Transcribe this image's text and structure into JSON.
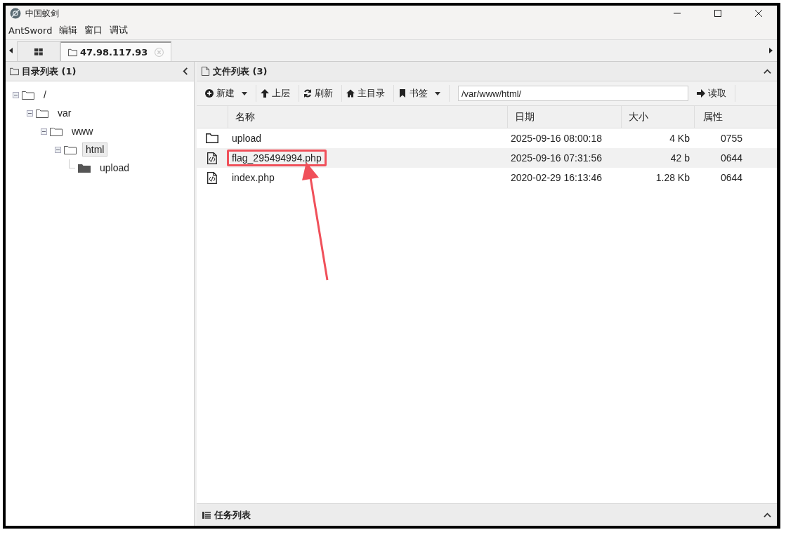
{
  "window": {
    "title": "中国蚁剑"
  },
  "menu": [
    "AntSword",
    "编辑",
    "窗口",
    "调试"
  ],
  "tabs": [
    {
      "label": "47.98.117.93",
      "selected": true
    }
  ],
  "dir_panel": {
    "title": "目录列表 (1)",
    "tree": [
      {
        "label": "/",
        "expanded": true,
        "selected": false,
        "children": [
          {
            "label": "var",
            "expanded": true,
            "selected": false,
            "children": [
              {
                "label": "www",
                "expanded": true,
                "selected": false,
                "children": [
                  {
                    "label": "html",
                    "expanded": true,
                    "selected": true,
                    "children": [
                      {
                        "label": "upload",
                        "expanded": false,
                        "selected": false
                      }
                    ]
                  }
                ]
              }
            ]
          }
        ]
      }
    ]
  },
  "file_panel": {
    "title": "文件列表 (3)",
    "toolbar": [
      {
        "label": "新建",
        "kind": "dropdown"
      },
      {
        "label": "上层",
        "kind": "button"
      },
      {
        "label": "刷新",
        "kind": "button"
      },
      {
        "label": "主目录",
        "kind": "button"
      },
      {
        "label": "书签",
        "kind": "dropdown"
      }
    ],
    "path": "/var/www/html/",
    "read_button": "读取",
    "columns": [
      "名称",
      "日期",
      "大小",
      "属性"
    ],
    "rows": [
      {
        "kind": "folder",
        "name": "upload",
        "date": "2025-09-16 08:00:18",
        "size": "4 Kb",
        "perm": "0755",
        "selected": false,
        "highlighted": false
      },
      {
        "kind": "file",
        "name": "flag_295494994.php",
        "date": "2025-09-16 07:31:56",
        "size": "42 b",
        "perm": "0644",
        "selected": true,
        "highlighted": true
      },
      {
        "kind": "file",
        "name": "index.php",
        "date": "2020-02-29 16:13:46",
        "size": "1.28 Kb",
        "perm": "0644",
        "selected": false,
        "highlighted": false
      }
    ]
  },
  "task_panel": {
    "title": "任务列表"
  }
}
